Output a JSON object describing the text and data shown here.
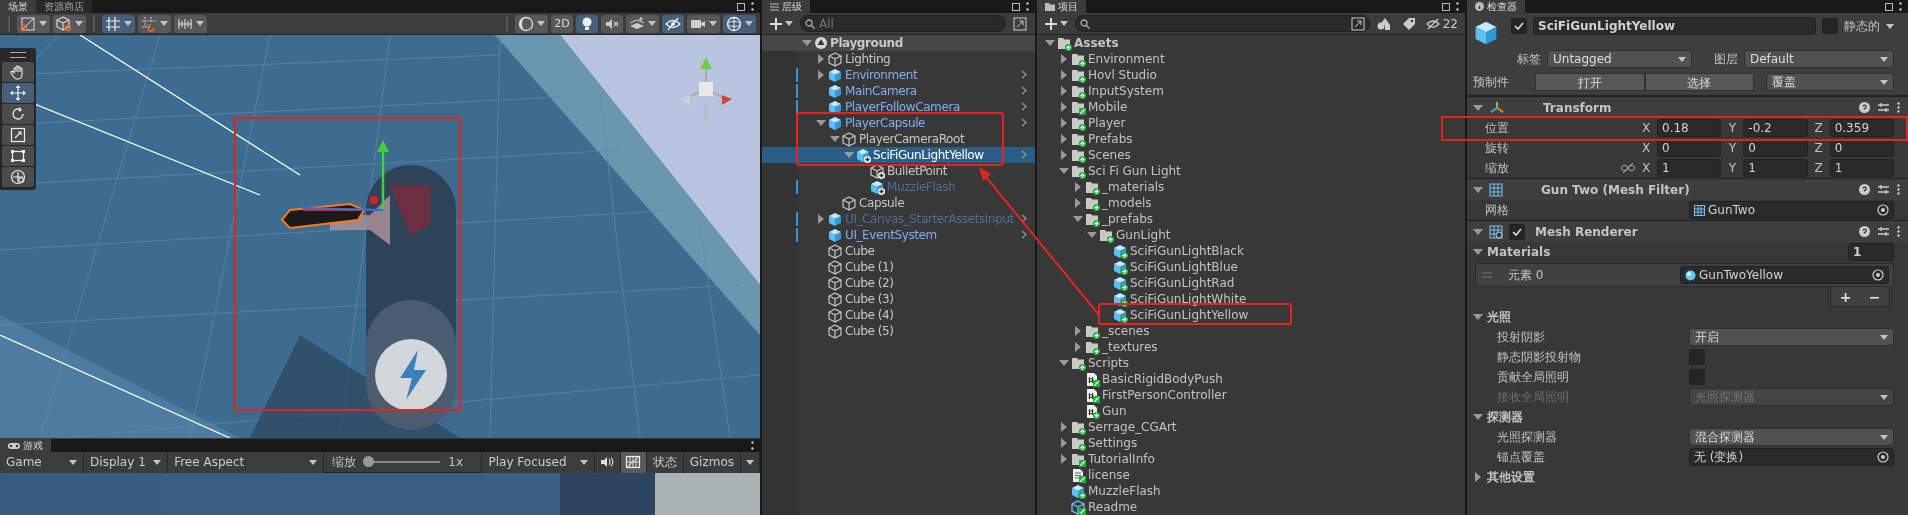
{
  "scene_view": {
    "tabs": [
      {
        "label": "场景",
        "selected": true
      },
      {
        "label": "资源商店",
        "selected": false
      }
    ],
    "toolbar_left": [
      {
        "kind": "draw-mode",
        "on": false
      },
      {
        "kind": "shading",
        "on": false
      },
      {
        "kind": "grid-snap",
        "on": true
      },
      {
        "kind": "increment-snap",
        "on": false
      },
      {
        "kind": "ruler",
        "on": false
      }
    ],
    "toolbar_right": [
      {
        "kind": "render-sphere",
        "on": false
      },
      {
        "kind": "text",
        "label": "2D",
        "on": false
      },
      {
        "kind": "light",
        "on": true
      },
      {
        "kind": "audio",
        "on": false
      },
      {
        "kind": "effects",
        "on": false
      },
      {
        "kind": "hidden-eye",
        "on": true
      },
      {
        "kind": "camera",
        "on": false
      },
      {
        "kind": "gizmo",
        "on": true
      }
    ],
    "tools": [
      {
        "kind": "hand",
        "selected": false
      },
      {
        "kind": "move",
        "selected": true
      },
      {
        "kind": "rotate",
        "selected": false
      },
      {
        "kind": "scale",
        "selected": false
      },
      {
        "kind": "rect",
        "selected": false
      },
      {
        "kind": "transform",
        "selected": false
      }
    ]
  },
  "game_view": {
    "tab": "游戏",
    "mode": "Game",
    "display": "Display 1",
    "aspect": "Free Aspect",
    "zoom_label": "缩放",
    "zoom": {
      "level": 0
    },
    "zoom_value": "1x",
    "play_mode": "Play Focused",
    "toggles": [
      {
        "kind": "mute",
        "on": false
      },
      {
        "kind": "grid",
        "on": true
      }
    ],
    "stats": "状态",
    "gizmos": "Gizmos"
  },
  "hierarchy": {
    "tab": "层级",
    "search": {
      "placeholder": "All"
    },
    "items": [
      {
        "name": "Playground",
        "kind": "scene",
        "expanded": true,
        "selected": false,
        "active": true,
        "overridden": false,
        "children": [
          {
            "name": "Lighting",
            "kind": "object",
            "expanded": false,
            "selected": false,
            "active": true,
            "overridden": false
          },
          {
            "name": "Environment",
            "kind": "prefab",
            "expanded": false,
            "selected": false,
            "active": true,
            "overridden": true
          },
          {
            "name": "MainCamera",
            "kind": "prefab",
            "selected": false,
            "active": true,
            "overridden": true
          },
          {
            "name": "PlayerFollowCamera",
            "kind": "prefab",
            "selected": false,
            "active": true,
            "overridden": true
          },
          {
            "name": "PlayerCapsule",
            "kind": "prefab",
            "expanded": true,
            "selected": false,
            "active": true,
            "overridden": true,
            "children": [
              {
                "name": "PlayerCameraRoot",
                "kind": "object",
                "expanded": true,
                "selected": false,
                "active": true,
                "overridden": false,
                "children": [
                  {
                    "name": "SciFiGunLightYellow",
                    "kind": "added-prefab",
                    "expanded": true,
                    "selected": true,
                    "active": true,
                    "overridden": true,
                    "children": [
                      {
                        "name": "BulletPoint",
                        "kind": "added-object",
                        "selected": false,
                        "active": true,
                        "overridden": false
                      },
                      {
                        "name": "MuzzleFlash",
                        "kind": "added-prefab",
                        "selected": false,
                        "active": false,
                        "overridden": true
                      }
                    ]
                  }
                ]
              },
              {
                "name": "Capsule",
                "kind": "object",
                "selected": false,
                "active": true,
                "overridden": false
              }
            ]
          },
          {
            "name": "UI_Canvas_StarterAssetsInput",
            "kind": "prefab",
            "expanded": false,
            "selected": false,
            "active": false,
            "overridden": true
          },
          {
            "name": "UI_EventSystem",
            "kind": "prefab",
            "selected": false,
            "active": true,
            "overridden": true
          },
          {
            "name": "Cube",
            "kind": "object",
            "selected": false,
            "active": true,
            "overridden": false
          },
          {
            "name": "Cube (1)",
            "kind": "object",
            "selected": false,
            "active": true,
            "overridden": false
          },
          {
            "name": "Cube (2)",
            "kind": "object",
            "selected": false,
            "active": true,
            "overridden": false
          },
          {
            "name": "Cube (3)",
            "kind": "object",
            "selected": false,
            "active": true,
            "overridden": false
          },
          {
            "name": "Cube (4)",
            "kind": "object",
            "selected": false,
            "active": true,
            "overridden": false
          },
          {
            "name": "Cube (5)",
            "kind": "object",
            "selected": false,
            "active": true,
            "overridden": false
          }
        ]
      }
    ]
  },
  "project": {
    "tab": "项目",
    "hidden_count": "22",
    "items": [
      {
        "name": "Assets",
        "kind": "folder",
        "edited": false,
        "expanded": true,
        "children": [
          {
            "name": "Environment",
            "kind": "folder",
            "edited": false,
            "expanded": false
          },
          {
            "name": "Hovl Studio",
            "kind": "folder",
            "edited": false,
            "expanded": false
          },
          {
            "name": "InputSystem",
            "kind": "folder",
            "edited": false,
            "expanded": false
          },
          {
            "name": "Mobile",
            "kind": "folder",
            "edited": true,
            "expanded": false
          },
          {
            "name": "Player",
            "kind": "folder",
            "edited": false,
            "expanded": false
          },
          {
            "name": "Prefabs",
            "kind": "folder",
            "edited": false,
            "expanded": false
          },
          {
            "name": "Scenes",
            "kind": "folder",
            "edited": false,
            "expanded": false
          },
          {
            "name": "Sci Fi Gun Light",
            "kind": "folder",
            "edited": false,
            "expanded": true,
            "children": [
              {
                "name": "_materials",
                "kind": "folder",
                "edited": false,
                "expanded": false
              },
              {
                "name": "_models",
                "kind": "folder",
                "edited": false,
                "expanded": false
              },
              {
                "name": "_prefabs",
                "kind": "folder",
                "edited": false,
                "expanded": true,
                "children": [
                  {
                    "name": "GunLight",
                    "kind": "folder",
                    "edited": false,
                    "expanded": true,
                    "children": [
                      {
                        "name": "SciFiGunLightBlack",
                        "kind": "prefab",
                        "edited": false
                      },
                      {
                        "name": "SciFiGunLightBlue",
                        "kind": "prefab",
                        "edited": false
                      },
                      {
                        "name": "SciFiGunLightRad",
                        "kind": "prefab",
                        "edited": false
                      },
                      {
                        "name": "SciFiGunLightWhite",
                        "kind": "prefab",
                        "edited": false
                      },
                      {
                        "name": "SciFiGunLightYellow",
                        "kind": "prefab",
                        "edited": false
                      }
                    ]
                  }
                ]
              },
              {
                "name": "_scenes",
                "kind": "folder",
                "edited": false,
                "expanded": false
              },
              {
                "name": "_textures",
                "kind": "folder",
                "edited": false,
                "expanded": false
              }
            ]
          },
          {
            "name": "Scripts",
            "kind": "folder",
            "edited": false,
            "expanded": true,
            "children": [
              {
                "name": "BasicRigidBodyPush",
                "kind": "script",
                "edited": true
              },
              {
                "name": "FirstPersonController",
                "kind": "script",
                "edited": true
              },
              {
                "name": "Gun",
                "kind": "script",
                "edited": false
              }
            ]
          },
          {
            "name": "Serrage_CGArt",
            "kind": "folder",
            "edited": false,
            "expanded": false
          },
          {
            "name": "Settings",
            "kind": "folder",
            "edited": false,
            "expanded": false
          },
          {
            "name": "TutorialInfo",
            "kind": "folder",
            "edited": true,
            "expanded": false
          },
          {
            "name": "license",
            "kind": "document",
            "edited": true
          },
          {
            "name": "MuzzleFlash",
            "kind": "prefab",
            "edited": false
          },
          {
            "name": "Readme",
            "kind": "asset",
            "edited": true
          }
        ]
      }
    ]
  },
  "inspector": {
    "tab": "检查器",
    "object": {
      "active": true,
      "name": "SciFiGunLightYellow",
      "static": false,
      "static_label": "静态的",
      "tag_label": "标签",
      "tag": "Untagged",
      "layer_label": "图层",
      "layer": "Default",
      "prefab_label": "预制件",
      "prefab_buttons": [
        "打开",
        "选择"
      ],
      "overrides": "覆盖"
    },
    "components": [
      {
        "kind": "transform",
        "title": "Transform",
        "expanded": true,
        "properties": [
          {
            "kind": "vector",
            "label": "位置",
            "fields": [
              {
                "axis": "X",
                "value": "0.18"
              },
              {
                "axis": "Y",
                "value": "-0.2"
              },
              {
                "axis": "Z",
                "value": "0.359"
              }
            ]
          },
          {
            "kind": "vector",
            "label": "旋转",
            "fields": [
              {
                "axis": "X",
                "value": "0"
              },
              {
                "axis": "Y",
                "value": "0"
              },
              {
                "axis": "Z",
                "value": "0"
              }
            ]
          },
          {
            "kind": "vector",
            "label": "缩放",
            "linked": false,
            "fields": [
              {
                "axis": "X",
                "value": "1"
              },
              {
                "axis": "Y",
                "value": "1"
              },
              {
                "axis": "Z",
                "value": "1"
              }
            ]
          }
        ]
      },
      {
        "kind": "mesh-filter",
        "title": "Gun Two (Mesh Filter)",
        "expanded": true,
        "properties": [
          {
            "kind": "object",
            "label": "网格",
            "value": "GunTwo",
            "asset": {
              "kind": "mesh"
            }
          }
        ]
      },
      {
        "kind": "mesh-renderer",
        "title": "Mesh Renderer",
        "expanded": true,
        "enabled": true,
        "sections": [
          {
            "kind": "list",
            "title": "Materials",
            "expanded": true,
            "count": "1",
            "items": [
              {
                "label": "元素 0",
                "value": "GunTwoYellow",
                "asset": {
                  "kind": "material"
                }
              }
            ],
            "buttons": [
              "+",
              "−"
            ]
          },
          {
            "kind": "props",
            "title": "光照",
            "expanded": true,
            "properties": [
              {
                "kind": "dropdown",
                "label": "投射阴影",
                "value": "开启",
                "disabled": false
              },
              {
                "kind": "checkbox",
                "label": "静态阴影投射物",
                "checked": false,
                "disabled": false
              },
              {
                "kind": "checkbox",
                "label": "贡献全局照明",
                "checked": false,
                "disabled": false
              },
              {
                "kind": "dropdown",
                "label": "接收全局照明",
                "value": "光照探测器",
                "disabled": true
              }
            ]
          },
          {
            "kind": "props",
            "title": "探测器",
            "expanded": true,
            "properties": [
              {
                "kind": "dropdown",
                "label": "光照探测器",
                "value": "混合探测器",
                "disabled": false
              },
              {
                "kind": "object",
                "label": "锚点覆盖",
                "value": "无 (变换)",
                "disabled": false
              }
            ]
          },
          {
            "kind": "props",
            "title": "其他设置",
            "expanded": false
          }
        ]
      }
    ]
  }
}
